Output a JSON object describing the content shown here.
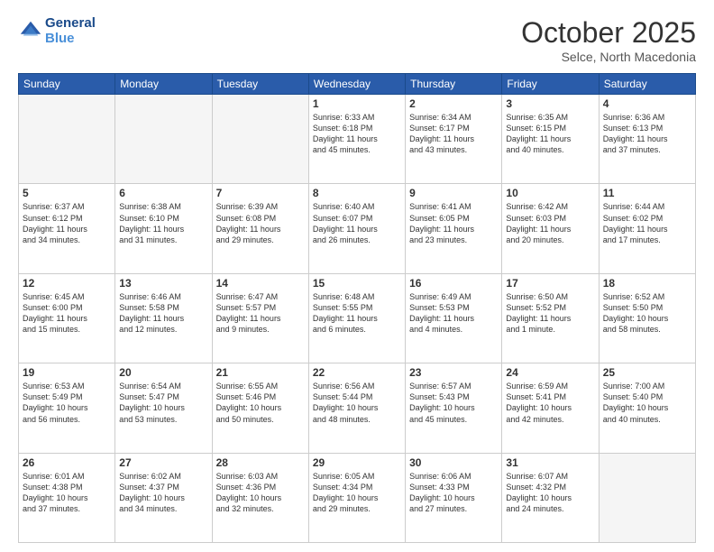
{
  "header": {
    "logo_line1": "General",
    "logo_line2": "Blue",
    "month": "October 2025",
    "location": "Selce, North Macedonia"
  },
  "days_of_week": [
    "Sunday",
    "Monday",
    "Tuesday",
    "Wednesday",
    "Thursday",
    "Friday",
    "Saturday"
  ],
  "weeks": [
    [
      {
        "num": "",
        "text": "",
        "empty": true
      },
      {
        "num": "",
        "text": "",
        "empty": true
      },
      {
        "num": "",
        "text": "",
        "empty": true
      },
      {
        "num": "1",
        "text": "Sunrise: 6:33 AM\nSunset: 6:18 PM\nDaylight: 11 hours\nand 45 minutes.",
        "empty": false
      },
      {
        "num": "2",
        "text": "Sunrise: 6:34 AM\nSunset: 6:17 PM\nDaylight: 11 hours\nand 43 minutes.",
        "empty": false
      },
      {
        "num": "3",
        "text": "Sunrise: 6:35 AM\nSunset: 6:15 PM\nDaylight: 11 hours\nand 40 minutes.",
        "empty": false
      },
      {
        "num": "4",
        "text": "Sunrise: 6:36 AM\nSunset: 6:13 PM\nDaylight: 11 hours\nand 37 minutes.",
        "empty": false
      }
    ],
    [
      {
        "num": "5",
        "text": "Sunrise: 6:37 AM\nSunset: 6:12 PM\nDaylight: 11 hours\nand 34 minutes.",
        "empty": false
      },
      {
        "num": "6",
        "text": "Sunrise: 6:38 AM\nSunset: 6:10 PM\nDaylight: 11 hours\nand 31 minutes.",
        "empty": false
      },
      {
        "num": "7",
        "text": "Sunrise: 6:39 AM\nSunset: 6:08 PM\nDaylight: 11 hours\nand 29 minutes.",
        "empty": false
      },
      {
        "num": "8",
        "text": "Sunrise: 6:40 AM\nSunset: 6:07 PM\nDaylight: 11 hours\nand 26 minutes.",
        "empty": false
      },
      {
        "num": "9",
        "text": "Sunrise: 6:41 AM\nSunset: 6:05 PM\nDaylight: 11 hours\nand 23 minutes.",
        "empty": false
      },
      {
        "num": "10",
        "text": "Sunrise: 6:42 AM\nSunset: 6:03 PM\nDaylight: 11 hours\nand 20 minutes.",
        "empty": false
      },
      {
        "num": "11",
        "text": "Sunrise: 6:44 AM\nSunset: 6:02 PM\nDaylight: 11 hours\nand 17 minutes.",
        "empty": false
      }
    ],
    [
      {
        "num": "12",
        "text": "Sunrise: 6:45 AM\nSunset: 6:00 PM\nDaylight: 11 hours\nand 15 minutes.",
        "empty": false
      },
      {
        "num": "13",
        "text": "Sunrise: 6:46 AM\nSunset: 5:58 PM\nDaylight: 11 hours\nand 12 minutes.",
        "empty": false
      },
      {
        "num": "14",
        "text": "Sunrise: 6:47 AM\nSunset: 5:57 PM\nDaylight: 11 hours\nand 9 minutes.",
        "empty": false
      },
      {
        "num": "15",
        "text": "Sunrise: 6:48 AM\nSunset: 5:55 PM\nDaylight: 11 hours\nand 6 minutes.",
        "empty": false
      },
      {
        "num": "16",
        "text": "Sunrise: 6:49 AM\nSunset: 5:53 PM\nDaylight: 11 hours\nand 4 minutes.",
        "empty": false
      },
      {
        "num": "17",
        "text": "Sunrise: 6:50 AM\nSunset: 5:52 PM\nDaylight: 11 hours\nand 1 minute.",
        "empty": false
      },
      {
        "num": "18",
        "text": "Sunrise: 6:52 AM\nSunset: 5:50 PM\nDaylight: 10 hours\nand 58 minutes.",
        "empty": false
      }
    ],
    [
      {
        "num": "19",
        "text": "Sunrise: 6:53 AM\nSunset: 5:49 PM\nDaylight: 10 hours\nand 56 minutes.",
        "empty": false
      },
      {
        "num": "20",
        "text": "Sunrise: 6:54 AM\nSunset: 5:47 PM\nDaylight: 10 hours\nand 53 minutes.",
        "empty": false
      },
      {
        "num": "21",
        "text": "Sunrise: 6:55 AM\nSunset: 5:46 PM\nDaylight: 10 hours\nand 50 minutes.",
        "empty": false
      },
      {
        "num": "22",
        "text": "Sunrise: 6:56 AM\nSunset: 5:44 PM\nDaylight: 10 hours\nand 48 minutes.",
        "empty": false
      },
      {
        "num": "23",
        "text": "Sunrise: 6:57 AM\nSunset: 5:43 PM\nDaylight: 10 hours\nand 45 minutes.",
        "empty": false
      },
      {
        "num": "24",
        "text": "Sunrise: 6:59 AM\nSunset: 5:41 PM\nDaylight: 10 hours\nand 42 minutes.",
        "empty": false
      },
      {
        "num": "25",
        "text": "Sunrise: 7:00 AM\nSunset: 5:40 PM\nDaylight: 10 hours\nand 40 minutes.",
        "empty": false
      }
    ],
    [
      {
        "num": "26",
        "text": "Sunrise: 6:01 AM\nSunset: 4:38 PM\nDaylight: 10 hours\nand 37 minutes.",
        "empty": false
      },
      {
        "num": "27",
        "text": "Sunrise: 6:02 AM\nSunset: 4:37 PM\nDaylight: 10 hours\nand 34 minutes.",
        "empty": false
      },
      {
        "num": "28",
        "text": "Sunrise: 6:03 AM\nSunset: 4:36 PM\nDaylight: 10 hours\nand 32 minutes.",
        "empty": false
      },
      {
        "num": "29",
        "text": "Sunrise: 6:05 AM\nSunset: 4:34 PM\nDaylight: 10 hours\nand 29 minutes.",
        "empty": false
      },
      {
        "num": "30",
        "text": "Sunrise: 6:06 AM\nSunset: 4:33 PM\nDaylight: 10 hours\nand 27 minutes.",
        "empty": false
      },
      {
        "num": "31",
        "text": "Sunrise: 6:07 AM\nSunset: 4:32 PM\nDaylight: 10 hours\nand 24 minutes.",
        "empty": false
      },
      {
        "num": "",
        "text": "",
        "empty": true
      }
    ]
  ]
}
